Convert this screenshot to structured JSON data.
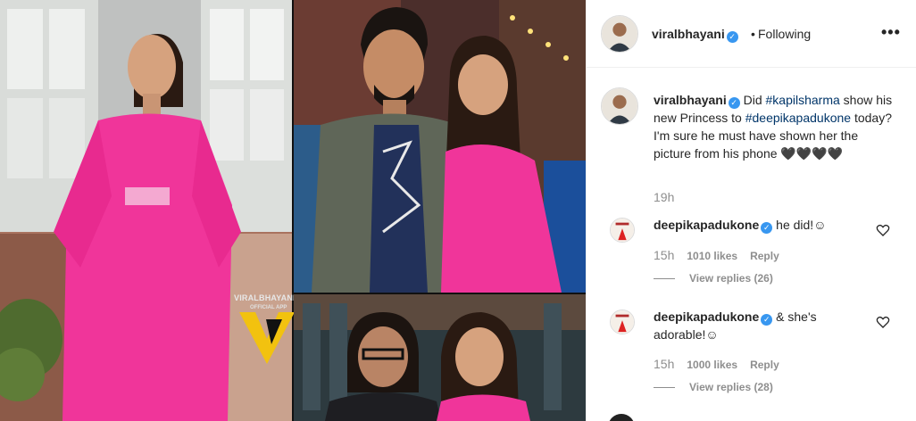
{
  "watermark": {
    "brand": "VIRALBHAYANI",
    "sub": "OFFICIAL APP"
  },
  "header": {
    "username": "viralbhayani",
    "verified_mark": "✓",
    "separator": "•",
    "follow_label": "Following",
    "more_label": "•••"
  },
  "caption": {
    "username": "viralbhayani",
    "text_before": "Did ",
    "hashtag1": "#kapilsharma",
    "text_middle": " show his new Princess to ",
    "hashtag2": "#deepikapadukone",
    "text_after": " today? I'm sure he must have shown her the picture from his phone 🖤🖤🖤🖤",
    "time": "19h"
  },
  "comments": [
    {
      "username": "deepikapadukone",
      "text": "he did!☺",
      "time": "15h",
      "likes": "1010 likes",
      "reply_label": "Reply",
      "view_replies": "View replies (26)"
    },
    {
      "username": "deepikapadukone",
      "text": "& she's adorable!☺",
      "time": "15h",
      "likes": "1000 likes",
      "reply_label": "Reply",
      "view_replies": "View replies (28)"
    }
  ],
  "icons": {
    "verified": "verified-badge-icon",
    "more": "more-options-icon",
    "heart": "heart-outline-icon"
  },
  "colors": {
    "accent": "#3897f0",
    "hashtag": "#003569",
    "secondary_text": "#8e8e8e",
    "dress_pink": "#f0359a"
  }
}
